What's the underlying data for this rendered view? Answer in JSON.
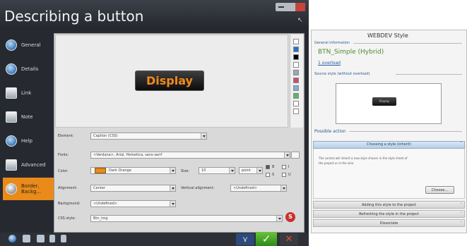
{
  "window": {
    "title": "Describing a button",
    "resize_glyph": "↖"
  },
  "sidebar": {
    "items": [
      {
        "label": "General",
        "icon": "general-icon"
      },
      {
        "label": "Details",
        "icon": "details-icon"
      },
      {
        "label": "Link",
        "icon": "link-icon"
      },
      {
        "label": "Note",
        "icon": "note-icon"
      },
      {
        "label": "Help",
        "icon": "help-icon"
      },
      {
        "label": "Advanced",
        "icon": "advanced-icon"
      },
      {
        "label": "Border, Backg...",
        "icon": "style-icon",
        "active": true
      }
    ]
  },
  "preview": {
    "button_label": "Display",
    "swatch_colors": [
      "#ffffff",
      "#2a6fc9",
      "#000000",
      "#ffffff",
      "#9aa7b5",
      "#c94b7a",
      "#7ab0d8",
      "#5bb56b",
      "#ffffff",
      "#ffffff"
    ]
  },
  "form": {
    "element_label": "Element:",
    "element_value": "Caption (CSS)",
    "fonts_label": "Fonts:",
    "fonts_value": "<Verdana>, Arial, Helvetica, sans-serif",
    "color_label": "Color:",
    "color_value": "Dark Orange",
    "color_hex": "#e98a19",
    "size_label": "Size:",
    "size_value": "10",
    "size_unit": "point",
    "style_checks": [
      "B",
      "I",
      "S",
      "U"
    ],
    "alignment_label": "Alignment:",
    "alignment_value": "Center",
    "valign_label": "Vertical alignment:",
    "valign_value": "<Undefined>",
    "background_label": "Background:",
    "background_value": "<Undefined>",
    "css_label": "CSS style:",
    "css_value": "Btn_Img"
  },
  "bottom_actions": {
    "expand": "⋎",
    "ok": "✓",
    "cancel": "✕"
  },
  "right_panel": {
    "title": "WEBDEV Style",
    "general_info_label": "General information",
    "style_name": "BTN_Simple (Hybrid)",
    "overloads": "1 overload",
    "source_style_label": "Source style (without overload)",
    "source_button_label": "Display",
    "possible_action_label": "Possible action",
    "choosing_style": "Choosing a style (inherit)",
    "choosing_desc_line1": "The control will inherit a new style chosen in the style sheet of",
    "choosing_desc_line2": "the project or in the skin.",
    "choose_button": "Choose...",
    "actions": [
      "Adding this style to the project",
      "Refreshing the style in the project",
      "Dissociate"
    ]
  }
}
